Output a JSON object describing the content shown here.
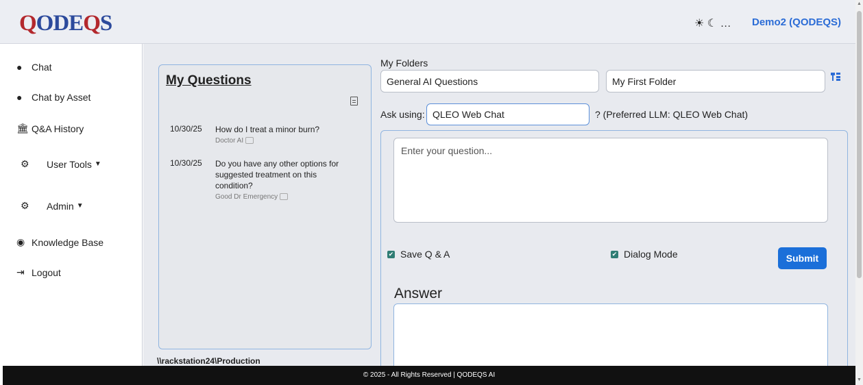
{
  "header": {
    "logo_q1": "Q",
    "logo_mid": "ODE",
    "logo_q2": "Q",
    "logo_end": "S",
    "theme_icons": "☀ ☾ …",
    "user": "Demo2 (QODEQS)"
  },
  "sidebar": {
    "items": [
      {
        "label": "Chat",
        "icon": "chat-bubble-icon"
      },
      {
        "label": "Chat by Asset",
        "icon": "chat-bubble-icon"
      },
      {
        "label": "Q&A History",
        "icon": "bank-icon"
      },
      {
        "label": "User Tools",
        "icon": "gears-icon"
      },
      {
        "label": "Admin",
        "icon": "gears-icon"
      },
      {
        "label": "Knowledge Base",
        "icon": "brain-icon"
      },
      {
        "label": "Logout",
        "icon": "logout-icon"
      }
    ]
  },
  "questions": {
    "title": "My Questions",
    "items": [
      {
        "date": "10/30/25",
        "text": "How do I treat a minor burn?",
        "source": "Doctor AI"
      },
      {
        "date": "10/30/25",
        "text": "Do you have any other options for suggested treatment on this condition?",
        "source": "Good Dr Emergency"
      }
    ],
    "path": "\\\\rackstation24\\Production"
  },
  "folders": {
    "label": "My Folders",
    "folder1": "General AI Questions",
    "folder2": "My First Folder"
  },
  "ask": {
    "label": "Ask using:",
    "value": "QLEO Web Chat",
    "preferred": "? (Preferred LLM: QLEO Web Chat)",
    "placeholder": "Enter your question...",
    "save_label": "Save Q & A",
    "dialog_label": "Dialog Mode",
    "submit": "Submit",
    "answer_heading": "Answer"
  },
  "footer": {
    "text": "© 2025 - All Rights Reserved | QODEQS AI"
  }
}
